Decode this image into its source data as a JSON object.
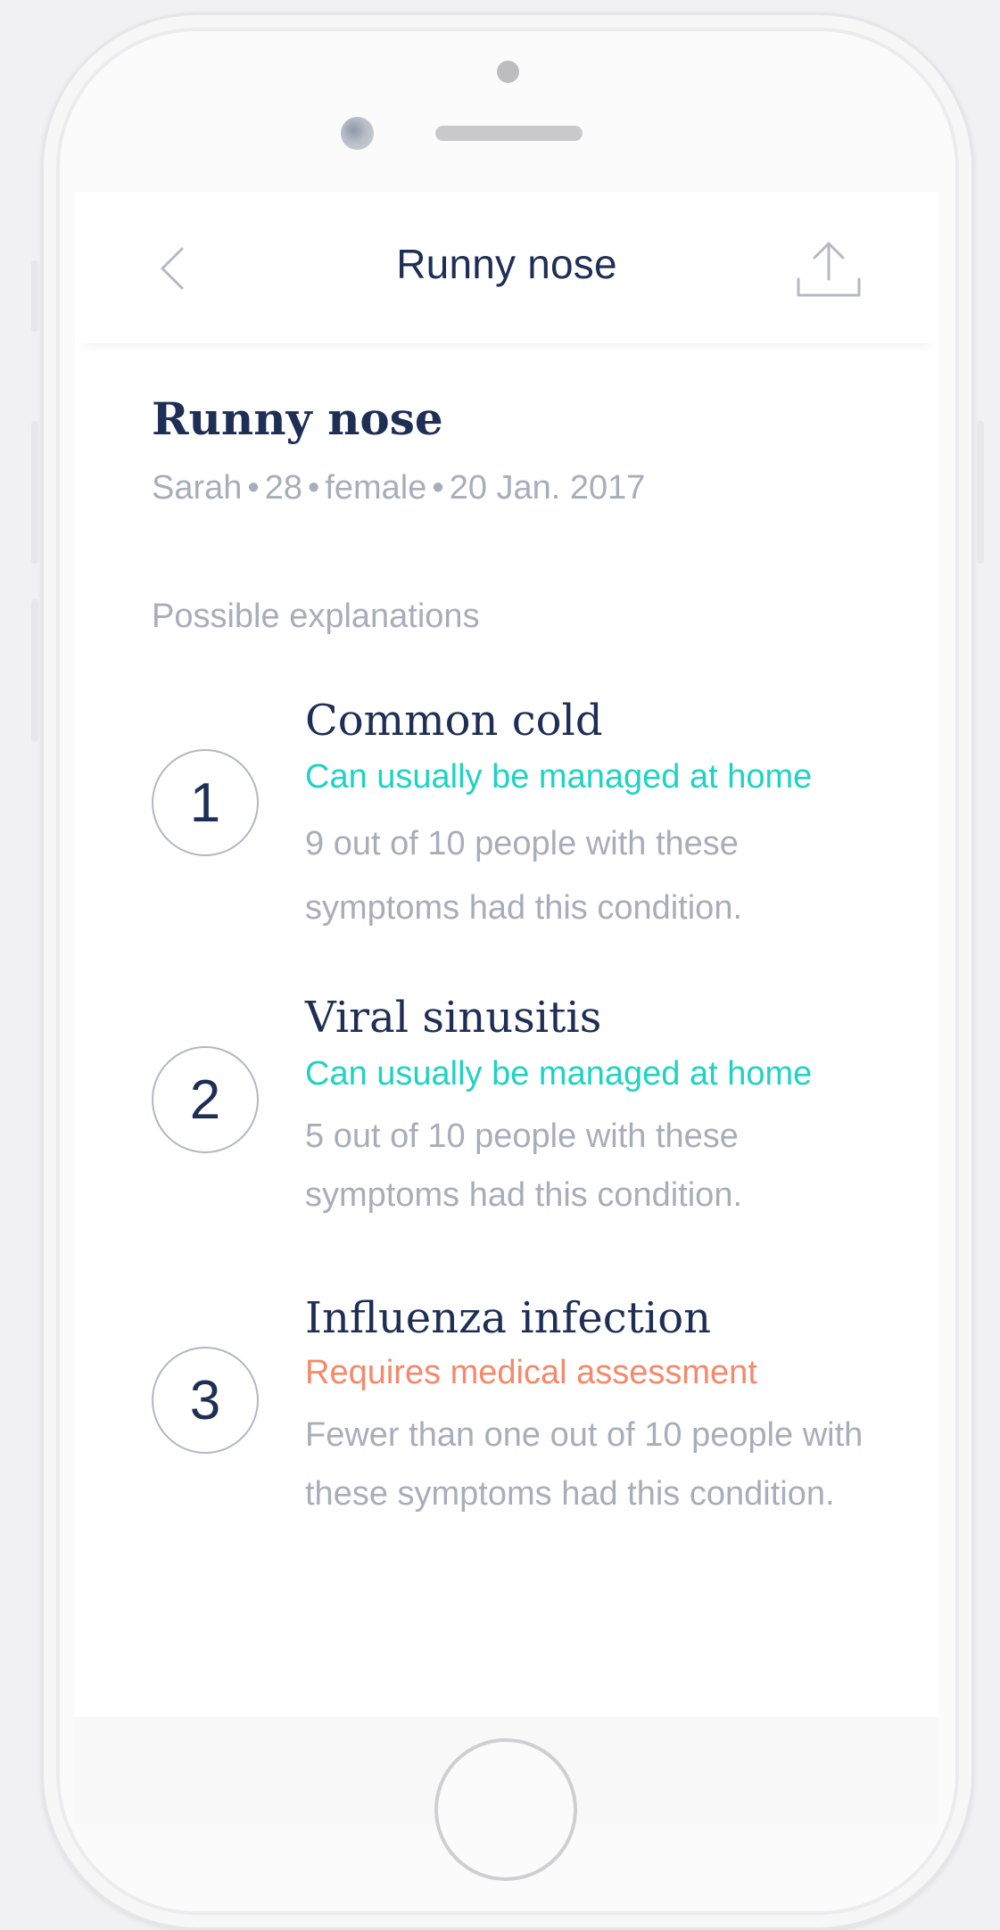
{
  "nav": {
    "title": "Runny nose"
  },
  "case": {
    "title": "Runny nose",
    "name": "Sarah",
    "age": "28",
    "sex": "female",
    "date": "20 Jan. 2017",
    "separator": "•"
  },
  "section_label": "Possible explanations",
  "explanations": [
    {
      "rank": "1",
      "name": "Common cold",
      "status": "Can usually be managed at home",
      "status_color": "#1fd3c3",
      "description": "9 out of 10 people with these symptoms had this condition."
    },
    {
      "rank": "2",
      "name": "Viral sinusitis",
      "status": "Can usually be managed at home",
      "status_color": "#1fd3c3",
      "description": "5 out of 10 people with these symptoms had this condition."
    },
    {
      "rank": "3",
      "name": "Influenza infection",
      "status": "Requires medical assessment",
      "status_color": "#f5896a",
      "description": "Fewer than one out of 10 people with these symptoms had this condition."
    }
  ],
  "icons": {
    "back": "chevron-left-icon",
    "share": "share-upload-icon"
  },
  "colors": {
    "primary_text": "#1e2e55",
    "secondary_text": "#a9adbb",
    "home_status": "#1fd3c3",
    "medical_status": "#f5896a"
  }
}
